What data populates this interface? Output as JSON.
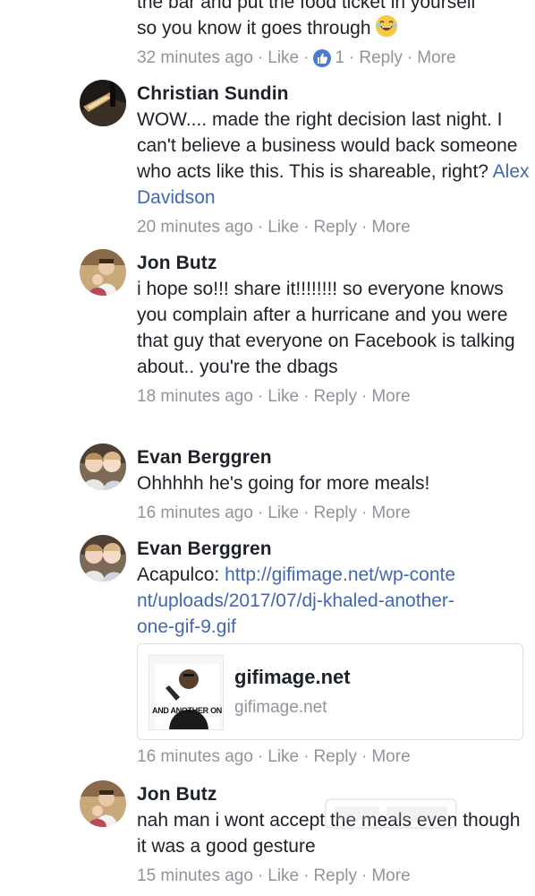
{
  "comments": [
    {
      "text_line1": "the bar and put the food ticket in yoursell",
      "text_line2": "so you know it goes through",
      "time": "32 minutes ago",
      "like": "Like",
      "like_count": "1",
      "reply": "Reply",
      "more": "More"
    },
    {
      "name": "Christian Sundin",
      "text": "WOW.... made the right decision last night. I can't believe a business would back someone who acts like this. This is shareable, right?",
      "tag": "Alex Davidson",
      "time": "20 minutes ago",
      "like": "Like",
      "reply": "Reply",
      "more": "More"
    },
    {
      "name": "Jon Butz",
      "text": "i hope so!!! share it!!!!!!!! so everyone knows you complain after a hurricane and you were that guy that everyone on Facebook is talking about.. you're the dbags",
      "time": "18 minutes ago",
      "like": "Like",
      "reply": "Reply",
      "more": "More"
    },
    {
      "name": "Evan Berggren",
      "text": "Ohhhhh he's going for more meals!",
      "time": "16 minutes ago",
      "like": "Like",
      "reply": "Reply",
      "more": "More"
    },
    {
      "name": "Evan Berggren",
      "text_prefix": "Acapulco:",
      "link": "http://gifimage.net/wp-content/uploads/2017/07/dj-khaled-another-one-gif-9.gif",
      "preview": {
        "title": "gifimage.net",
        "domain": "gifimage.net",
        "thumb_caption": "AND ANOTHER ON"
      },
      "time": "16 minutes ago",
      "like": "Like",
      "reply": "Reply",
      "more": "More"
    },
    {
      "name": "Jon Butz",
      "text": "nah man i wont accept the meals even though it was a good gesture",
      "time": "15 minutes ago",
      "like": "Like",
      "reply": "Reply",
      "more": "More"
    }
  ],
  "icons": {
    "like_badge": "thumbs-up-icon",
    "emoji": "laughing-emoji-icon"
  },
  "colors": {
    "link": "#4267b2",
    "meta": "#90949c",
    "text": "#1d2129",
    "like_badge": "#4a7bd0"
  }
}
